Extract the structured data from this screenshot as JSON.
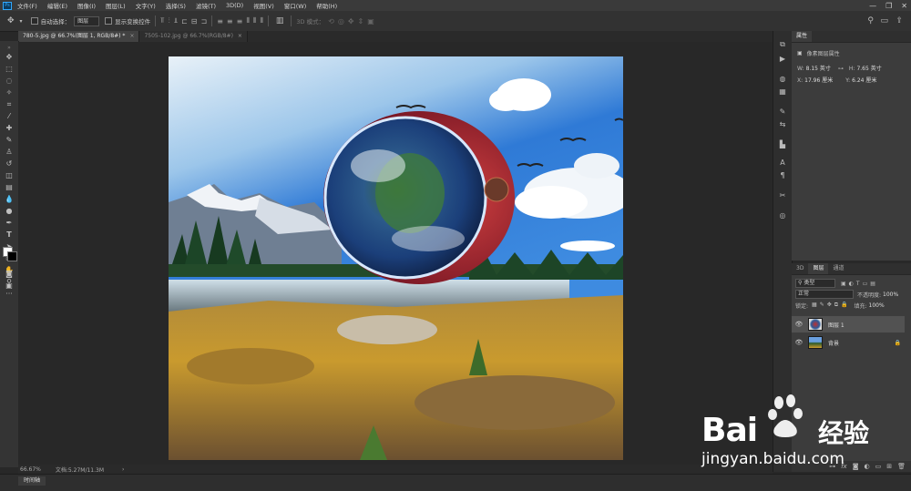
{
  "menubar": {
    "app_icon": "Ps",
    "items": [
      "文件(F)",
      "编辑(E)",
      "图像(I)",
      "图层(L)",
      "文字(Y)",
      "选择(S)",
      "滤镜(T)",
      "3D(D)",
      "视图(V)",
      "窗口(W)",
      "帮助(H)"
    ],
    "window_controls": [
      "—",
      "❐",
      "✕"
    ]
  },
  "options": {
    "auto_select_label": "自动选择：",
    "auto_select_value": "图层",
    "show_transform_label": "显示变换控件",
    "mode_3d_label": "3D 模式："
  },
  "tabs": [
    {
      "label": "780-5.jpg @ 66.7%(图层 1, RGB/8#) *",
      "active": true
    },
    {
      "label": "7505-102.jpg @ 66.7%(RGB/8#)",
      "active": false
    }
  ],
  "status": {
    "zoom": "66.67%",
    "doc_info": "文档:5.27M/11.3M",
    "arrow": "›"
  },
  "timeline": {
    "label": "时间轴"
  },
  "properties": {
    "title": "属性",
    "section": "像素图层属性",
    "w_label": "W:",
    "w_value": "8.15 英寸",
    "h_label": "H:",
    "h_value": "7.65 英寸",
    "x_label": "X:",
    "x_value": "17.96 厘米",
    "y_label": "Y:",
    "y_value": "6.24 厘米"
  },
  "layers_panel": {
    "tabs": [
      "3D",
      "图层",
      "通道"
    ],
    "filter_label": "类型",
    "blend_mode": "正常",
    "opacity_label": "不透明度:",
    "opacity_value": "100%",
    "lock_label": "锁定:",
    "fill_label": "填充:",
    "fill_value": "100%",
    "layers": [
      {
        "name": "图层 1",
        "selected": true
      },
      {
        "name": "背景",
        "selected": false
      }
    ],
    "footer_icons": [
      "link-icon",
      "fx-icon",
      "mask-icon",
      "adjustment-icon",
      "folder-icon",
      "new-layer-icon",
      "trash-icon"
    ]
  },
  "watermark": {
    "brand": "Bai",
    "brand_tail": "经验",
    "url": "jingyan.baidu.com"
  },
  "colors": {
    "sky_top": "#2f7ad6",
    "accent_blue": "#31a8ff",
    "grass": "#c99a2e",
    "watermark_red": "#d8262b"
  }
}
